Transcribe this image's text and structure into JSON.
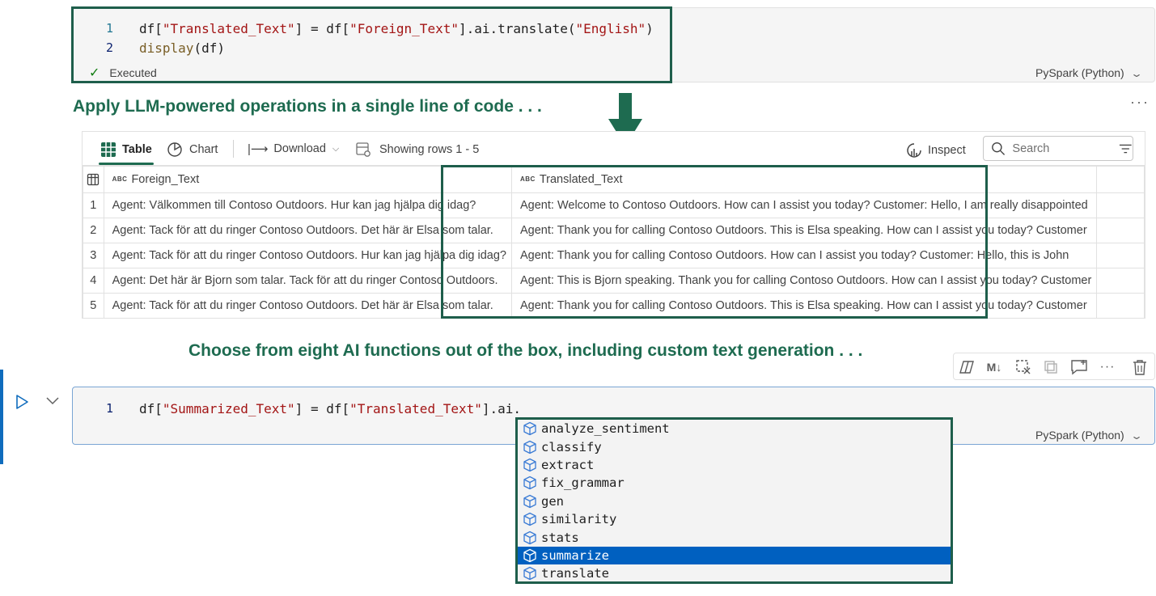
{
  "cell1": {
    "line_numbers": [
      "1",
      "2"
    ],
    "line1": {
      "p1": "df[",
      "s1": "\"Translated_Text\"",
      "p2": "] = df[",
      "s2": "\"Foreign_Text\"",
      "p3": "].ai.translate(",
      "s3": "\"English\"",
      "p4": ")"
    },
    "line2": {
      "fn": "display",
      "rest": "(df)"
    },
    "status": "Executed",
    "language": "PySpark (Python)"
  },
  "caption_top": "Apply LLM-powered operations in a single line of code . . .",
  "caption_mid": "Choose from eight AI functions out of the box, including custom text generation . . .",
  "more_label": "···",
  "output": {
    "toolbar": {
      "table": "Table",
      "chart": "Chart",
      "download": "Download",
      "showing": "Showing rows 1 - 5",
      "inspect": "Inspect",
      "search_placeholder": "Search"
    },
    "columns": {
      "type_label": "ABC",
      "foreign": "Foreign_Text",
      "translated": "Translated_Text"
    },
    "rows": [
      {
        "n": "1",
        "foreign": "Agent: Välkommen till Contoso Outdoors. Hur kan jag hjälpa dig idag?",
        "translated": "Agent: Welcome to Contoso Outdoors. How can I assist you today? Customer: Hello, I am really disappointed"
      },
      {
        "n": "2",
        "foreign": "Agent: Tack för att du ringer Contoso Outdoors. Det här är Elsa som talar.",
        "translated": "Agent: Thank you for calling Contoso Outdoors. This is Elsa speaking. How can I assist you today? Customer"
      },
      {
        "n": "3",
        "foreign": "Agent: Tack för att du ringer Contoso Outdoors. Hur kan jag hjälpa dig idag?",
        "translated": "Agent: Thank you for calling Contoso Outdoors. How can I assist you today? Customer: Hello, this is John"
      },
      {
        "n": "4",
        "foreign": "Agent: Det här är Bjorn som talar. Tack för att du ringer Contoso Outdoors.",
        "translated": "Agent: This is Bjorn speaking. Thank you for calling Contoso Outdoors. How can I assist you today? Customer"
      },
      {
        "n": "5",
        "foreign": "Agent: Tack för att du ringer Contoso Outdoors. Det här är Elsa som talar.",
        "translated": "Agent: Thank you for calling Contoso Outdoors. This is Elsa speaking. How can I assist you today? Customer"
      }
    ]
  },
  "cell_toolbar": {
    "markdown_label": "M↓",
    "more_label": "···"
  },
  "cell2": {
    "line_number": "1",
    "line1": {
      "p1": "df[",
      "s1": "\"Summarized_Text\"",
      "p2": "] = df[",
      "s2": "\"Translated_Text\"",
      "p3": "].ai."
    },
    "language": "PySpark (Python)"
  },
  "suggestions": [
    {
      "label": "analyze_sentiment",
      "selected": false
    },
    {
      "label": "classify",
      "selected": false
    },
    {
      "label": "extract",
      "selected": false
    },
    {
      "label": "fix_grammar",
      "selected": false
    },
    {
      "label": "gen",
      "selected": false
    },
    {
      "label": "similarity",
      "selected": false
    },
    {
      "label": "stats",
      "selected": false
    },
    {
      "label": "summarize",
      "selected": true
    },
    {
      "label": "translate",
      "selected": false
    }
  ],
  "colors": {
    "accent_green": "#1e6b50",
    "highlight_border": "#1e5e4b",
    "selection_blue": "#0060c0",
    "string_red": "#a31515",
    "function_brown": "#795e26",
    "line_number": "#237893",
    "focus_bar": "#0f6cbd"
  }
}
